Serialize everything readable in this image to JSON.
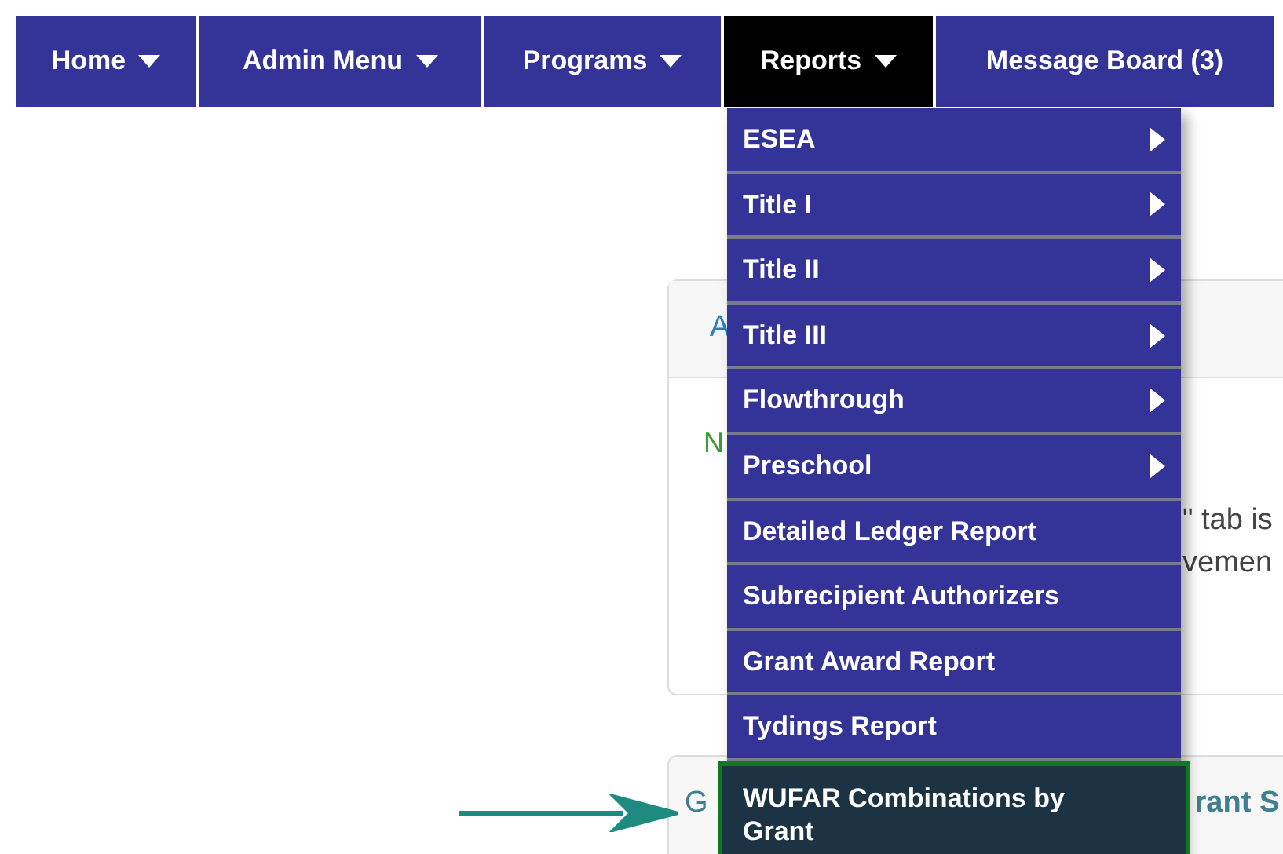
{
  "nav": [
    {
      "label": "Home",
      "dropdown": true,
      "selected": false
    },
    {
      "label": "Admin Menu",
      "dropdown": true,
      "selected": false
    },
    {
      "label": "Programs",
      "dropdown": true,
      "selected": false
    },
    {
      "label": "Reports",
      "dropdown": true,
      "selected": true
    },
    {
      "label": "Message Board (3)",
      "dropdown": false,
      "selected": false
    }
  ],
  "cards": [
    {
      "header": "A",
      "body_start": "N",
      "body_lines": [
        "\" tab is",
        "vemen"
      ]
    },
    {
      "header": "G",
      "header_end": "rant S"
    }
  ],
  "reports_menu": [
    {
      "label": "ESEA",
      "submenu": true,
      "highlighted": false
    },
    {
      "label": "Title I",
      "submenu": true,
      "highlighted": false
    },
    {
      "label": "Title II",
      "submenu": true,
      "highlighted": false
    },
    {
      "label": "Title III",
      "submenu": true,
      "highlighted": false
    },
    {
      "label": "Flowthrough",
      "submenu": true,
      "highlighted": false
    },
    {
      "label": "Preschool",
      "submenu": true,
      "highlighted": false
    },
    {
      "label": "Detailed Ledger Report",
      "submenu": false,
      "highlighted": false
    },
    {
      "label": "Subrecipient Authorizers",
      "submenu": false,
      "highlighted": false
    },
    {
      "label": "Grant Award Report",
      "submenu": false,
      "highlighted": false
    },
    {
      "label": "Tydings Report",
      "submenu": false,
      "highlighted": false
    },
    {
      "label": "WUFAR Combinations by Grant",
      "submenu": false,
      "highlighted": true
    }
  ]
}
